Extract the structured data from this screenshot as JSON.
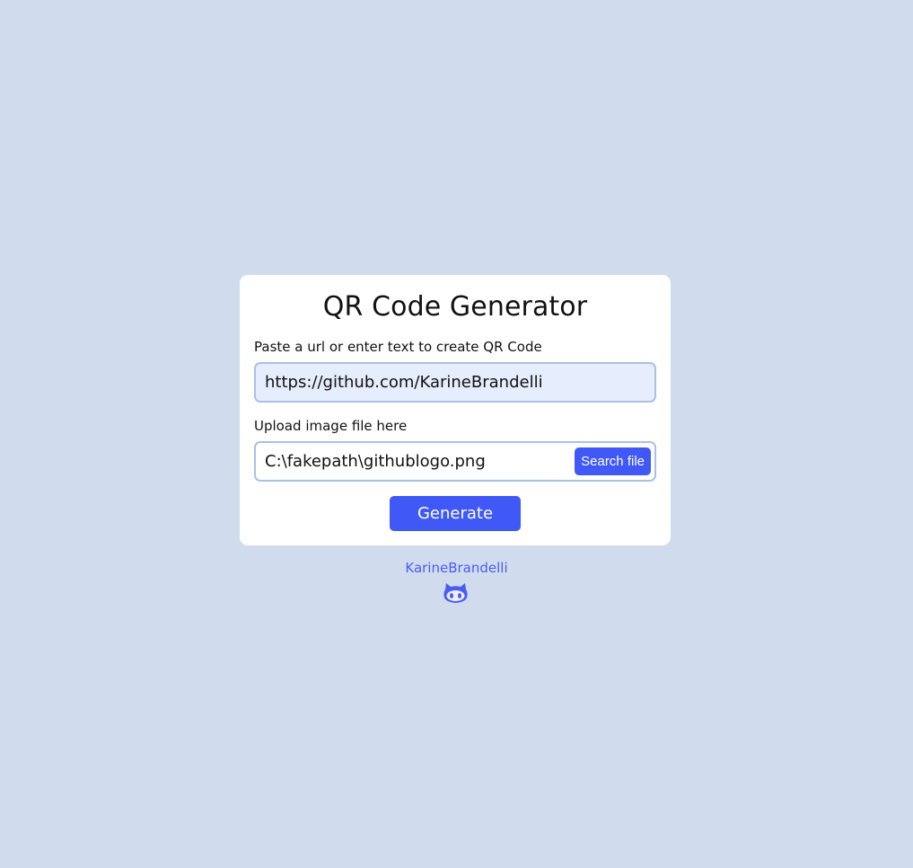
{
  "app": {
    "title": "QR Code Generator"
  },
  "url_input": {
    "label": "Paste a url or enter text to create QR Code",
    "value": "https://github.com/KarineBrandelli",
    "placeholder": ""
  },
  "file_input": {
    "label": "Upload image file here",
    "value": "C:\\fakepath\\githublogo.png",
    "button_label": "Search file"
  },
  "actions": {
    "generate_label": "Generate"
  },
  "footer": {
    "author": "KarineBrandelli",
    "icon": "github-icon"
  },
  "colors": {
    "background": "#d0dcee",
    "card": "#ffffff",
    "accent": "#4059f6",
    "input_border": "#a9c1e4",
    "input_fill": "#e6edfc"
  }
}
